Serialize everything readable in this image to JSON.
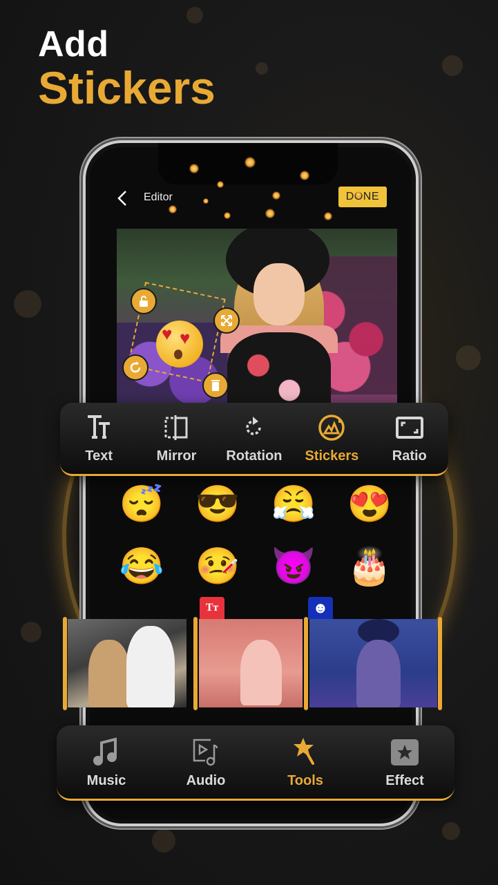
{
  "headline": {
    "line1": "Add",
    "line2": "Stickers"
  },
  "editor": {
    "title": "Editor",
    "done_label": "DONE",
    "back_icon": "chevron-left-icon"
  },
  "sticker_controls": {
    "sticker": "heart-eyes-emoji",
    "handles": [
      "lock-open-icon",
      "resize-arrows-icon",
      "rotate-icon",
      "trash-icon"
    ]
  },
  "toolbar": {
    "active": "Stickers",
    "items": [
      {
        "label": "Text",
        "icon": "text-size-icon"
      },
      {
        "label": "Mirror",
        "icon": "mirror-icon"
      },
      {
        "label": "Rotation",
        "icon": "rotate-icon"
      },
      {
        "label": "Stickers",
        "icon": "sticker-icon"
      },
      {
        "label": "Ratio",
        "icon": "aspect-ratio-icon"
      }
    ]
  },
  "stickers": [
    {
      "name": "sleeping-face",
      "glyph": "😴"
    },
    {
      "name": "sunglasses-face",
      "glyph": "😎"
    },
    {
      "name": "frowning-fists-face",
      "glyph": "😤"
    },
    {
      "name": "heart-eyes-face",
      "glyph": "😍"
    },
    {
      "name": "tears-of-joy-face",
      "glyph": "😂"
    },
    {
      "name": "thumbs-up-thermometer-face",
      "glyph": "🤒"
    },
    {
      "name": "purple-devil-face",
      "glyph": "😈"
    },
    {
      "name": "birthday-cake",
      "glyph": "🎂"
    }
  ],
  "timeline": {
    "clips": [
      {
        "name": "couple-selfie",
        "badge": null
      },
      {
        "name": "bride-street",
        "badge": {
          "icon": "text-size-icon",
          "glyph": "Tт",
          "color": "#e8333c"
        }
      },
      {
        "name": "girl-flowers",
        "badge": {
          "icon": "smiley-icon",
          "glyph": "☻",
          "color": "#1530b8"
        }
      }
    ]
  },
  "bottom_nav": {
    "active": "Tools",
    "items": [
      {
        "label": "Music",
        "icon": "music-note-icon"
      },
      {
        "label": "Audio",
        "icon": "audio-video-icon"
      },
      {
        "label": "Tools",
        "icon": "magic-wand-star-icon"
      },
      {
        "label": "Effect",
        "icon": "star-box-icon"
      }
    ]
  },
  "colors": {
    "accent": "#e8aa35",
    "done_button": "#f0c33a",
    "text_badge": "#e8333c",
    "sticker_badge": "#1530b8"
  }
}
